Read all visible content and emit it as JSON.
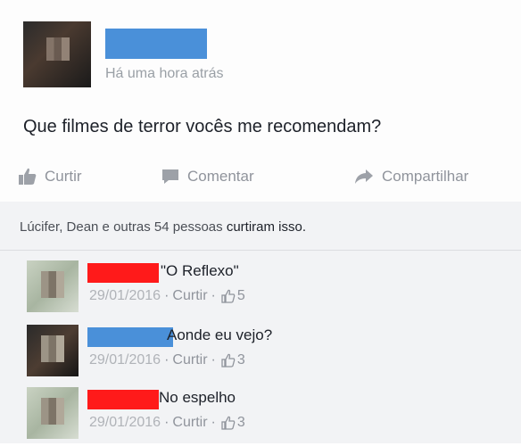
{
  "post": {
    "timestamp": "Há uma hora atrás",
    "text": "Que filmes de terror vocês me recomendam?"
  },
  "actions": {
    "like": "Curtir",
    "comment": "Comentar",
    "share": "Compartilhar"
  },
  "likes": {
    "names": "Lúcifer,  Dean e outras 54 pessoas",
    "suffix": "curtiram isso."
  },
  "comments": [
    {
      "text": "\"O Reflexo\"",
      "date": "29/01/2016",
      "like_label": "Curtir",
      "sep": "·",
      "likes": "5"
    },
    {
      "text": "Aonde eu vejo?",
      "date": "29/01/2016",
      "like_label": "Curtir",
      "sep": "·",
      "likes": "3"
    },
    {
      "text": "No espelho",
      "date": "29/01/2016",
      "like_label": "Curtir",
      "sep": "·",
      "likes": "3"
    }
  ],
  "colors": {
    "redaction_blue": "#4a90d9",
    "redaction_red": "#ff1a1a",
    "muted_text": "#90949c",
    "comments_bg": "#f2f3f5"
  }
}
